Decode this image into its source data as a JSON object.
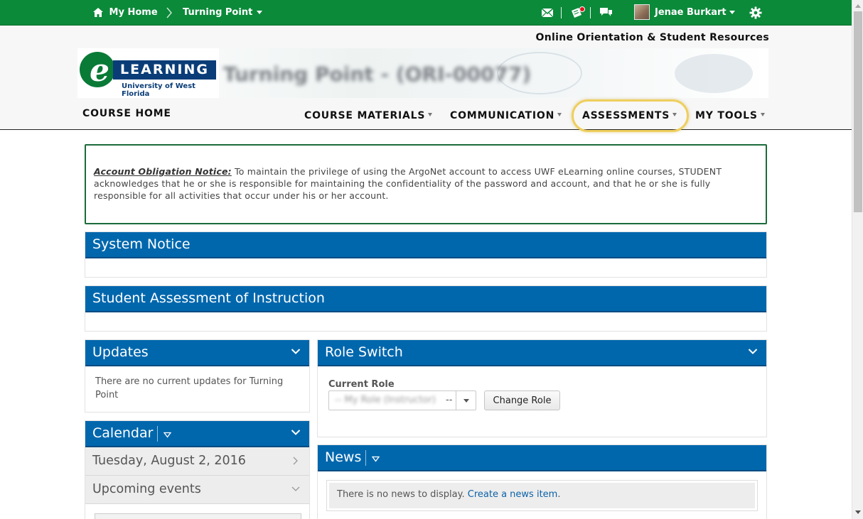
{
  "topbar": {
    "home_label": "My Home",
    "course_label": "Turning Point",
    "user_name": "Jenae Burkart",
    "icons": [
      "home-icon",
      "breadcrumb-chevron-icon",
      "email-icon",
      "updates-icon",
      "chat-icon",
      "gear-icon"
    ],
    "accent_color": "#0b8a3a"
  },
  "header": {
    "site_link": "Online Orientation & Student Resources",
    "logo": {
      "letter": "e",
      "word": "LEARNING",
      "subtitle": "University of West Florida"
    },
    "blurred_course_title": "Turning Point - (ORI-00077)"
  },
  "nav": {
    "course_home": "COURSE HOME",
    "items": [
      {
        "label": "COURSE MATERIALS"
      },
      {
        "label": "COMMUNICATION"
      },
      {
        "label": "ASSESSMENTS",
        "highlighted": true
      },
      {
        "label": "MY TOOLS"
      }
    ]
  },
  "notice": {
    "label": "Account Obligation Notice:",
    "text": " To maintain the privilege of using the ArgoNet account to access UWF eLearning online courses, STUDENT acknowledges that he or she is responsible for maintaining the confidentiality of the password and account, and that he or she is fully responsible for all activities that occur under his or her account."
  },
  "widgets": {
    "system_notice": {
      "title": "System Notice"
    },
    "sai": {
      "title": "Student Assessment of Instruction"
    },
    "updates": {
      "title": "Updates",
      "body": "There are no current updates for Turning Point"
    },
    "calendar": {
      "title": "Calendar",
      "date": "Tuesday, August 2, 2016",
      "upcoming": "Upcoming events"
    },
    "role_switch": {
      "title": "Role Switch",
      "current_role_label": "Current Role",
      "selected_role": "-- My Role (Instructor)",
      "suffix": "--",
      "button": "Change Role"
    },
    "news": {
      "title": "News",
      "empty_text": "There is no news to display. ",
      "create_link": "Create a news item",
      "trailing": "."
    }
  },
  "colors": {
    "widget_header": "#0067ad",
    "highlight_ring": "#efcf5d",
    "link": "#0c62a8"
  }
}
